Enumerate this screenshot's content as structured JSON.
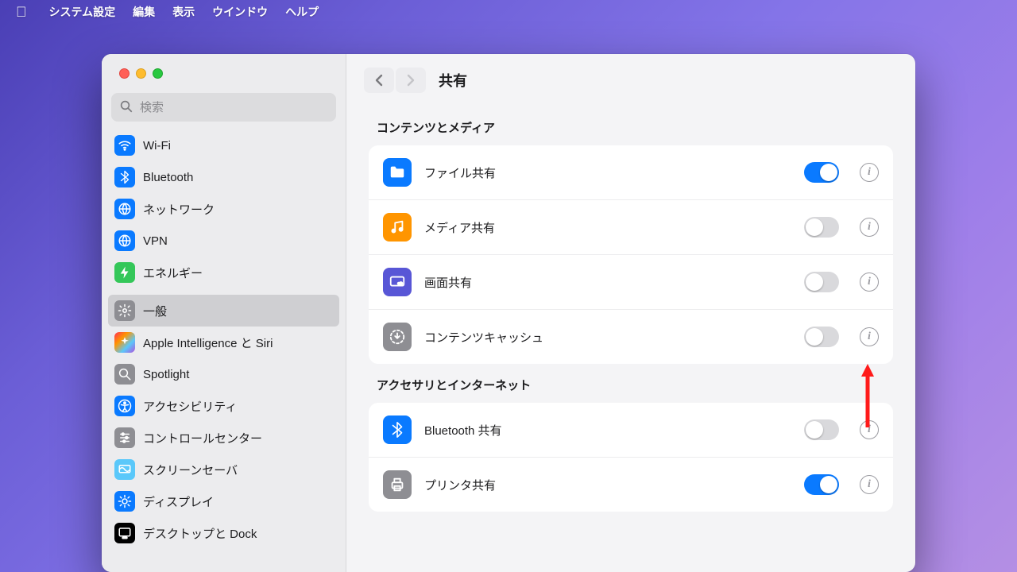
{
  "menubar": {
    "app": "システム設定",
    "items": [
      "編集",
      "表示",
      "ウインドウ",
      "ヘルプ"
    ]
  },
  "search": {
    "placeholder": "検索"
  },
  "sidebar": {
    "groups": [
      [
        {
          "k": "wifi",
          "label": "Wi-Fi",
          "color": "#0a7aff",
          "icon": "wifi"
        },
        {
          "k": "bluetooth",
          "label": "Bluetooth",
          "color": "#0a7aff",
          "icon": "bluetooth"
        },
        {
          "k": "network",
          "label": "ネットワーク",
          "color": "#0a7aff",
          "icon": "globe"
        },
        {
          "k": "vpn",
          "label": "VPN",
          "color": "#0a7aff",
          "icon": "globe"
        },
        {
          "k": "energy",
          "label": "エネルギー",
          "color": "#34c759",
          "icon": "bolt"
        }
      ],
      [
        {
          "k": "general",
          "label": "一般",
          "color": "#8e8e93",
          "icon": "gear",
          "selected": true
        },
        {
          "k": "ai-siri",
          "label": "Apple Intelligence と Siri",
          "color": "grad",
          "icon": "sparkle"
        },
        {
          "k": "spotlight",
          "label": "Spotlight",
          "color": "#8e8e93",
          "icon": "search"
        },
        {
          "k": "a11y",
          "label": "アクセシビリティ",
          "color": "#0a7aff",
          "icon": "a11y"
        },
        {
          "k": "cc",
          "label": "コントロールセンター",
          "color": "#8e8e93",
          "icon": "sliders"
        },
        {
          "k": "ss",
          "label": "スクリーンセーバ",
          "color": "#5ac8fa",
          "icon": "screensaver"
        },
        {
          "k": "display",
          "label": "ディスプレイ",
          "color": "#0a7aff",
          "icon": "sun"
        },
        {
          "k": "dock",
          "label": "デスクトップと Dock",
          "color": "#000000",
          "icon": "dock"
        }
      ]
    ]
  },
  "content": {
    "title": "共有",
    "sections": [
      {
        "title": "コンテンツとメディア",
        "rows": [
          {
            "k": "file-sharing",
            "label": "ファイル共有",
            "color": "#0a7aff",
            "icon": "folder",
            "on": true
          },
          {
            "k": "media-sharing",
            "label": "メディア共有",
            "color": "#ff9500",
            "icon": "music",
            "on": false
          },
          {
            "k": "screen-sharing",
            "label": "画面共有",
            "color": "#5856d6",
            "icon": "screen",
            "on": false
          },
          {
            "k": "content-cache",
            "label": "コンテンツキャッシュ",
            "color": "#8e8e93",
            "icon": "download",
            "on": false
          }
        ]
      },
      {
        "title": "アクセサリとインターネット",
        "rows": [
          {
            "k": "bt-sharing",
            "label": "Bluetooth 共有",
            "color": "#0a7aff",
            "icon": "bluetooth",
            "on": false
          },
          {
            "k": "printer-sharing",
            "label": "プリンタ共有",
            "color": "#8e8e93",
            "icon": "printer",
            "on": true
          }
        ]
      }
    ]
  }
}
